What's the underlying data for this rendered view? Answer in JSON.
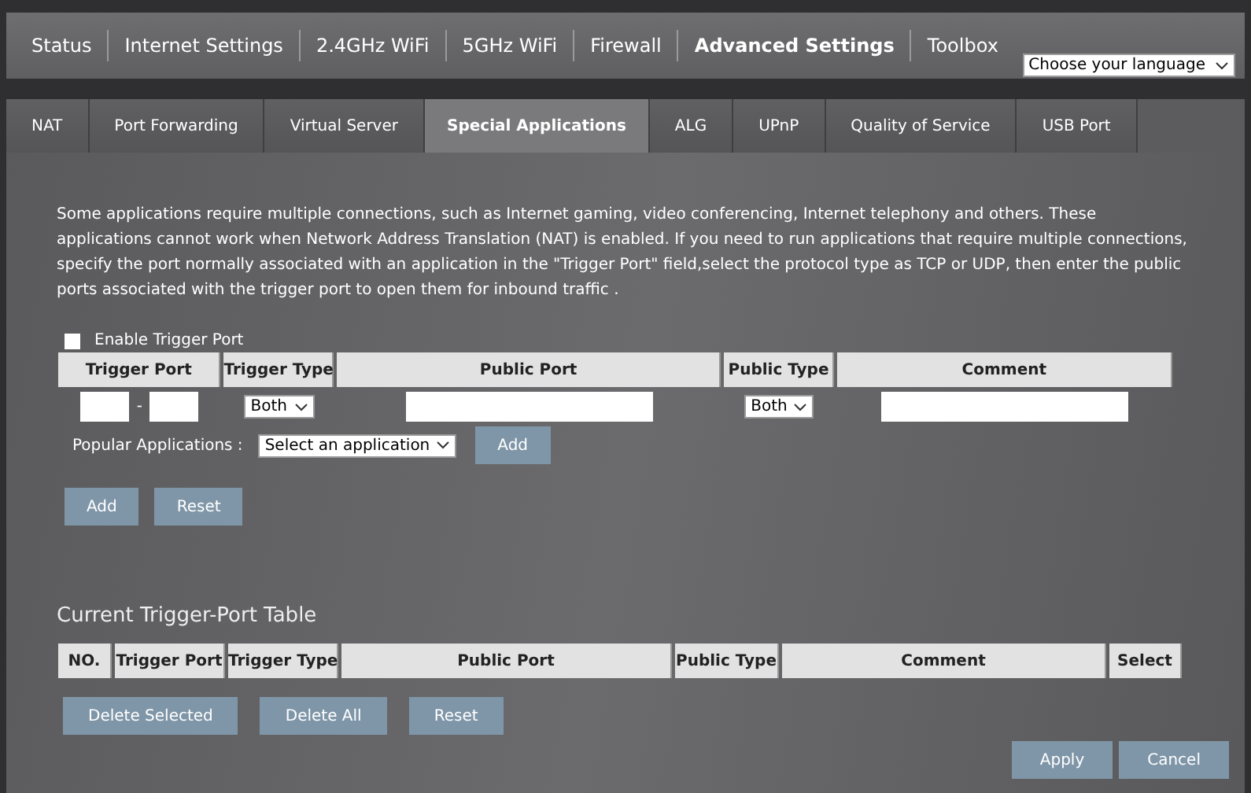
{
  "nav": [
    {
      "label": "Status",
      "selected": false
    },
    {
      "label": "Internet Settings",
      "selected": false
    },
    {
      "label": "2.4GHz WiFi",
      "selected": false
    },
    {
      "label": "5GHz WiFi",
      "selected": false
    },
    {
      "label": "Firewall",
      "selected": false
    },
    {
      "label": "Advanced Settings",
      "selected": true
    },
    {
      "label": "Toolbox",
      "selected": false
    }
  ],
  "language": {
    "value": "Choose your language"
  },
  "tabs": [
    {
      "label": "NAT",
      "selected": false
    },
    {
      "label": "Port Forwarding",
      "selected": false
    },
    {
      "label": "Virtual Server",
      "selected": false
    },
    {
      "label": "Special Applications",
      "selected": true
    },
    {
      "label": "ALG",
      "selected": false
    },
    {
      "label": "UPnP",
      "selected": false
    },
    {
      "label": "Quality of Service",
      "selected": false
    },
    {
      "label": "USB Port",
      "selected": false
    }
  ],
  "description": "Some applications require multiple connections, such as Internet gaming, video conferencing, Internet telephony and others. These applications cannot work when Network Address Translation (NAT) is enabled. If you need to run applications that require multiple connections, specify the port normally associated with an application in the \"Trigger Port\" field,select the protocol type as TCP or UDP, then enter the public ports associated with the trigger port to open them for inbound traffic .",
  "enable_trigger": {
    "label": "Enable Trigger Port",
    "checked": false
  },
  "form_table": {
    "columns": [
      "Trigger Port",
      "Trigger Type",
      "Public Port",
      "Public Type",
      "Comment"
    ],
    "separator": "-",
    "trigger_type": "Both",
    "public_type": "Both"
  },
  "popular": {
    "label": "Popular Applications :",
    "value": "Select an application",
    "button": "Add"
  },
  "form_buttons": [
    "Add",
    "Reset"
  ],
  "current_table": {
    "title": "Current Trigger-Port Table",
    "columns": [
      "NO.",
      "Trigger Port",
      "Trigger Type",
      "Public Port",
      "Public Type",
      "Comment",
      "Select"
    ]
  },
  "table_buttons": [
    "Delete Selected",
    "Delete All",
    "Reset"
  ],
  "footer_buttons": [
    "Apply",
    "Cancel"
  ]
}
